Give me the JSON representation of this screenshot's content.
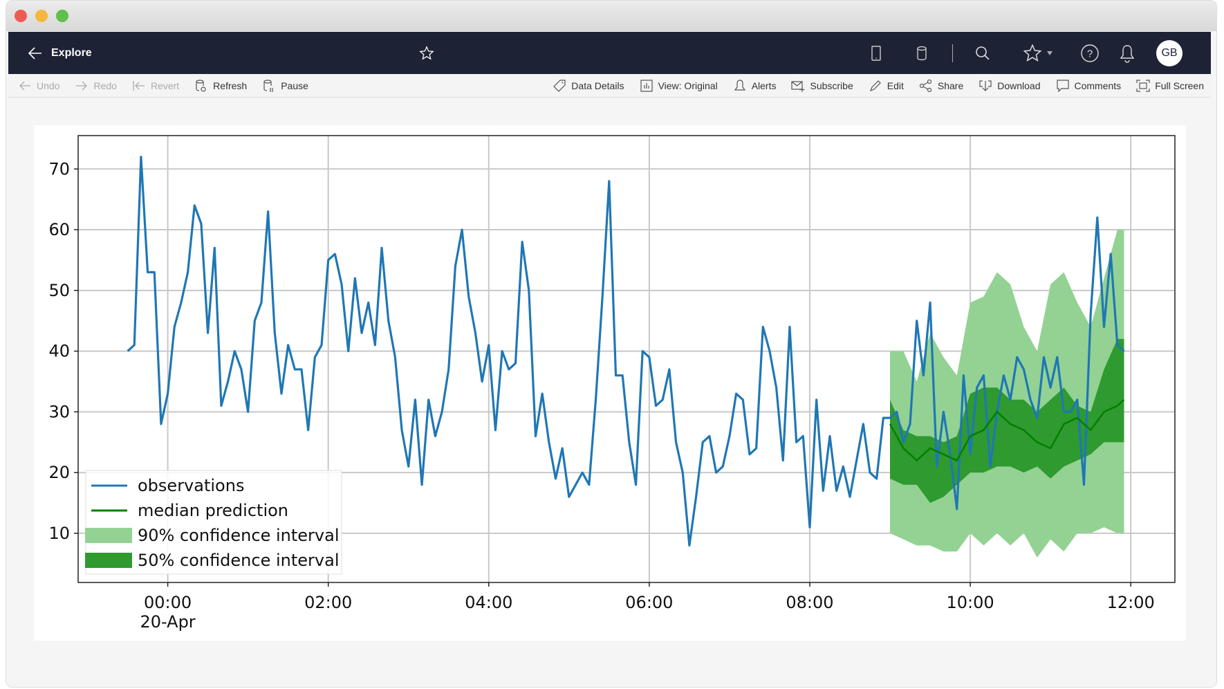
{
  "window": {
    "traffic_lights": [
      "#ee5b52",
      "#f5b83d",
      "#5fc04b"
    ]
  },
  "nav": {
    "back_label": "Explore",
    "icons": [
      "back-arrow-icon",
      "star-icon",
      "tablet-icon",
      "database-icon",
      "search-icon",
      "star-icon",
      "caret-down-icon",
      "help-icon",
      "bell-icon"
    ],
    "avatar_initials": "GB",
    "background": "#1e2235"
  },
  "toolbar": {
    "left": [
      {
        "label": "Undo",
        "icon": "undo-icon",
        "disabled": true
      },
      {
        "label": "Redo",
        "icon": "redo-icon",
        "disabled": true
      },
      {
        "label": "Revert",
        "icon": "revert-icon",
        "disabled": true
      },
      {
        "label": "Refresh",
        "icon": "refresh-icon",
        "disabled": false
      },
      {
        "label": "Pause",
        "icon": "pause-icon",
        "disabled": false
      }
    ],
    "right": [
      {
        "label": "Data Details",
        "icon": "tag-icon"
      },
      {
        "label": "View: Original",
        "icon": "view-icon"
      },
      {
        "label": "Alerts",
        "icon": "alert-bell-icon"
      },
      {
        "label": "Subscribe",
        "icon": "subscribe-icon"
      },
      {
        "label": "Edit",
        "icon": "pencil-icon"
      },
      {
        "label": "Share",
        "icon": "share-icon"
      },
      {
        "label": "Download",
        "icon": "download-icon"
      },
      {
        "label": "Comments",
        "icon": "comment-icon"
      },
      {
        "label": "Full Screen",
        "icon": "fullscreen-icon"
      }
    ]
  },
  "chart_data": {
    "type": "line",
    "title": "",
    "xlabel": "",
    "ylabel": "",
    "grid": true,
    "legend_placement": "bottom-left",
    "ylim": [
      1.9,
      75.5
    ],
    "xlim": [
      "22:53",
      "12:33"
    ],
    "yticks": [
      10,
      20,
      30,
      40,
      50,
      60,
      70
    ],
    "xticks": [
      {
        "t": "00:00",
        "label": "00:00",
        "sublabel": "20-Apr"
      },
      {
        "t": "02:00",
        "label": "02:00"
      },
      {
        "t": "04:00",
        "label": "04:00"
      },
      {
        "t": "06:00",
        "label": "06:00"
      },
      {
        "t": "08:00",
        "label": "08:00"
      },
      {
        "t": "10:00",
        "label": "10:00"
      },
      {
        "t": "12:00",
        "label": "12:00"
      }
    ],
    "colors": {
      "observations": "#1f77b4",
      "median": "#008000",
      "ci90": "#93d293",
      "ci50": "#2f9a2f"
    },
    "legend": [
      "observations",
      "median prediction",
      "90% confidence interval",
      "50% confidence interval"
    ],
    "observations": {
      "start": "23:30",
      "step_minutes": 5,
      "values": [
        40,
        41,
        72,
        53,
        53,
        28,
        33,
        44,
        48,
        53,
        64,
        61,
        43,
        57,
        31,
        35,
        40,
        37,
        30,
        45,
        48,
        63,
        43,
        33,
        41,
        37,
        37,
        27,
        39,
        41,
        55,
        56,
        51,
        40,
        52,
        43,
        48,
        41,
        57,
        45,
        39,
        27,
        21,
        32,
        18,
        32,
        26,
        30,
        37,
        54,
        60,
        49,
        43,
        35,
        41,
        27,
        40,
        37,
        38,
        58,
        50,
        26,
        33,
        25,
        19,
        24,
        16,
        18,
        20,
        18,
        32,
        49,
        68,
        36,
        36,
        25,
        18,
        40,
        39,
        31,
        32,
        37,
        25,
        20,
        8,
        16,
        25,
        26,
        20,
        21,
        26,
        33,
        32,
        23,
        24,
        44,
        40,
        34,
        22,
        44,
        25,
        26,
        11,
        32,
        17,
        26,
        17,
        21,
        16,
        22,
        28,
        20,
        19,
        29,
        29,
        30,
        25,
        28,
        45,
        36,
        48,
        21,
        30,
        23,
        14,
        36,
        23,
        34,
        36,
        21,
        30,
        36,
        32,
        39,
        37,
        32,
        29,
        39,
        34,
        39,
        30,
        30,
        32,
        18,
        46,
        62,
        44,
        56,
        41,
        40
      ]
    },
    "forecast": {
      "t": [
        "09:00",
        "09:10",
        "09:20",
        "09:30",
        "09:40",
        "09:50",
        "10:00",
        "10:10",
        "10:20",
        "10:30",
        "10:40",
        "10:50",
        "11:00",
        "11:10",
        "11:20",
        "11:30",
        "11:40",
        "11:50",
        "11:55"
      ],
      "median": [
        28,
        24,
        22,
        24,
        23,
        22,
        26,
        27,
        30,
        28,
        27,
        25,
        24,
        28,
        29,
        27,
        30,
        31,
        32
      ],
      "p5": [
        10,
        9,
        8,
        8,
        7,
        7,
        10,
        8,
        10,
        8,
        10,
        6,
        9,
        7,
        10,
        10,
        11,
        10,
        10
      ],
      "p25": [
        19,
        18,
        18,
        15,
        16,
        18,
        20,
        20,
        21,
        21,
        20,
        21,
        19,
        21,
        22,
        23,
        25,
        25,
        25
      ],
      "p75": [
        32,
        27,
        26,
        26,
        25,
        26,
        33,
        34,
        34,
        32,
        32,
        30,
        32,
        34,
        31,
        30,
        37,
        42,
        42
      ],
      "p95": [
        40,
        40,
        35,
        43,
        39,
        36,
        48,
        49,
        53,
        51,
        44,
        40,
        51,
        53,
        48,
        44,
        52,
        60,
        60
      ]
    }
  }
}
